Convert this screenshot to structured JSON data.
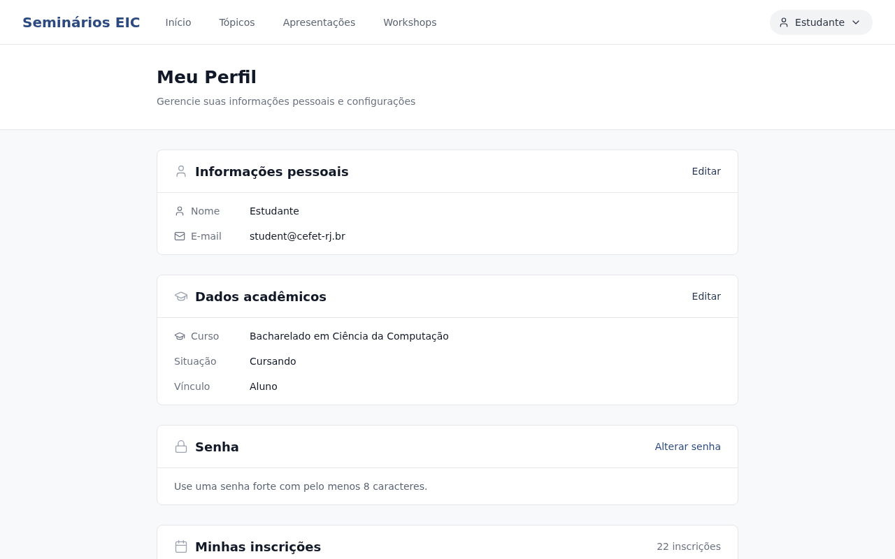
{
  "navbar": {
    "brand": "Seminários EIC",
    "links": [
      {
        "label": "Início"
      },
      {
        "label": "Tópicos"
      },
      {
        "label": "Apresentações"
      },
      {
        "label": "Workshops"
      }
    ],
    "user_menu": {
      "label": "Estudante"
    }
  },
  "page_header": {
    "title": "Meu Perfil",
    "subtitle": "Gerencie suas informações pessoais e configurações"
  },
  "cards": [
    {
      "kind": "personal",
      "title": "Informações pessoais",
      "action": "Editar",
      "fields": [
        {
          "kind": "person",
          "label": "Nome",
          "value": "Estudante"
        },
        {
          "kind": "mail",
          "label": "E-mail",
          "value": "student@cefet-rj.br"
        }
      ]
    },
    {
      "kind": "academic",
      "title": "Dados acadêmicos",
      "action": "Editar",
      "fields": [
        {
          "kind": "cap",
          "label": "Curso",
          "value": "Bacharelado em Ciência da Computação"
        },
        {
          "kind": "plain",
          "label": "Situação",
          "value": "Cursando"
        },
        {
          "kind": "plain",
          "label": "Vínculo",
          "value": "Aluno"
        }
      ]
    },
    {
      "kind": "password",
      "title": "Senha",
      "action": "Alterar senha",
      "note": "Use uma senha forte com pelo menos 8 caracteres."
    },
    {
      "kind": "registrations",
      "title": "Minhas inscrições",
      "count": "22 inscrições"
    }
  ]
}
